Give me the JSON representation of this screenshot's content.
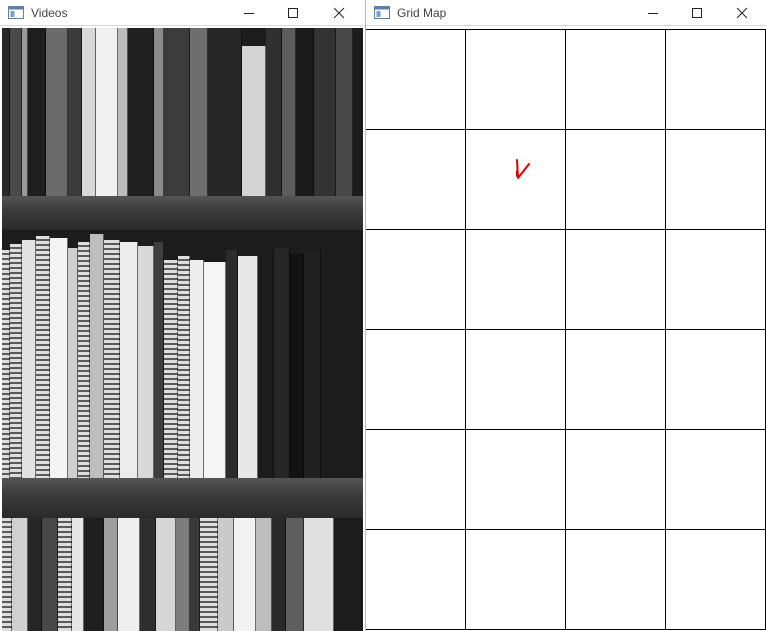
{
  "video_window": {
    "title": "Videos",
    "icon": "app-window-icon",
    "controls": [
      "minimize-icon",
      "maximize-icon",
      "close-icon"
    ]
  },
  "grid_window": {
    "title": "Grid Map",
    "icon": "app-window-icon",
    "controls": [
      "minimize-icon",
      "maximize-icon",
      "close-icon"
    ]
  },
  "grid": {
    "columns": 4,
    "rows": 6,
    "line_color": "#000000",
    "marker": {
      "icon": "robot-direction-icon",
      "column": 2,
      "row": 2,
      "color": "#e00000"
    }
  },
  "colors": {
    "titlebar_bg": "#ffffff",
    "title_text": "#444444",
    "shelf_board": "#3c3c3c",
    "video_background": "#1c1c1c"
  }
}
